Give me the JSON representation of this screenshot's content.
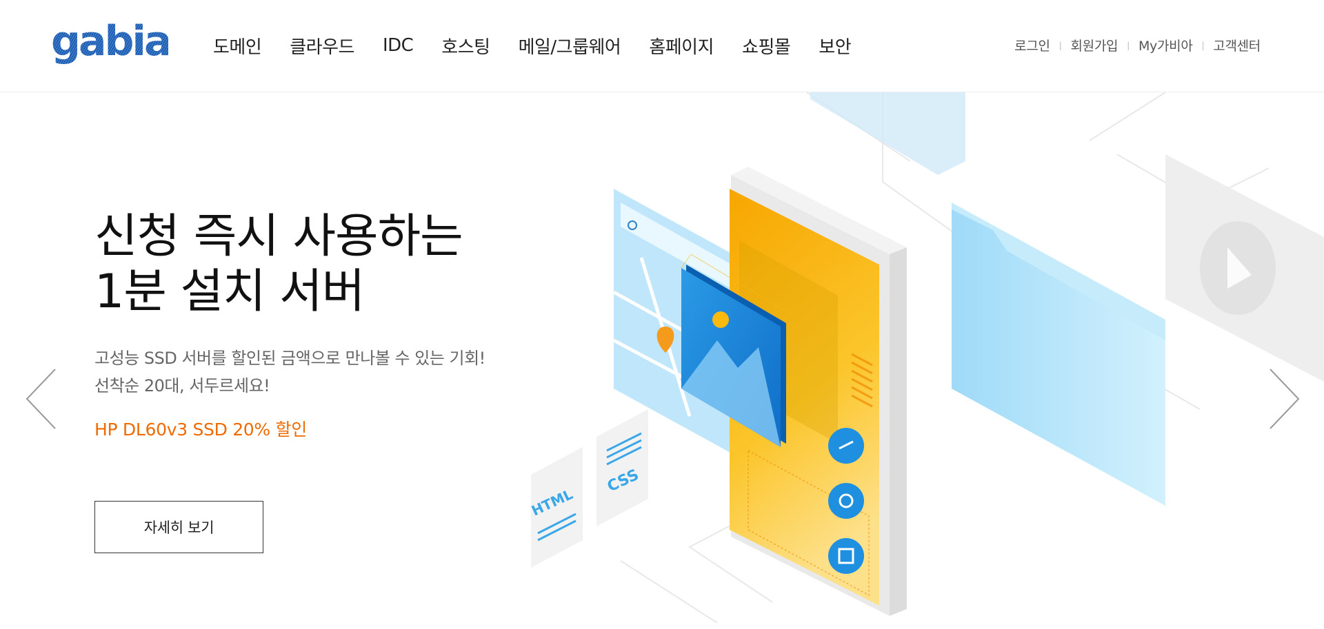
{
  "header": {
    "logo_text": "gabia.",
    "nav": [
      "도메인",
      "클라우드",
      "IDC",
      "호스팅",
      "메일/그룹웨어",
      "홈페이지",
      "쇼핑몰",
      "보안"
    ],
    "util": {
      "login": "로그인",
      "signup": "회원가입",
      "my": "My가비아",
      "support": "고객센터",
      "separator": "|"
    }
  },
  "hero": {
    "headline_line1": "신청 즉시 사용하는",
    "headline_line2": "1분 설치 서버",
    "sub_line1": "고성능 SSD 서버를 할인된 금액으로 만나볼 수 있는 기회!",
    "sub_line2": "선착순 20대, 서두르세요!",
    "promo": "HP DL60v3 SSD 20% 할인",
    "button": "자세히 보기",
    "illustration": {
      "tag_html": "HTML",
      "tag_css": "CSS",
      "icons": [
        "search-icon",
        "map-pin-icon",
        "image-icon",
        "link-icon",
        "camera-icon",
        "crop-icon",
        "play-icon"
      ]
    }
  },
  "carousel": {
    "prev_icon": "chevron-left-icon",
    "next_icon": "chevron-right-icon"
  },
  "colors": {
    "promo": "#f06a00",
    "logo_blue": "#1d5fb8",
    "accent_yellow": "#f9b90f",
    "accent_blue": "#1f8fe0",
    "light_blue": "#b8e6fb"
  }
}
